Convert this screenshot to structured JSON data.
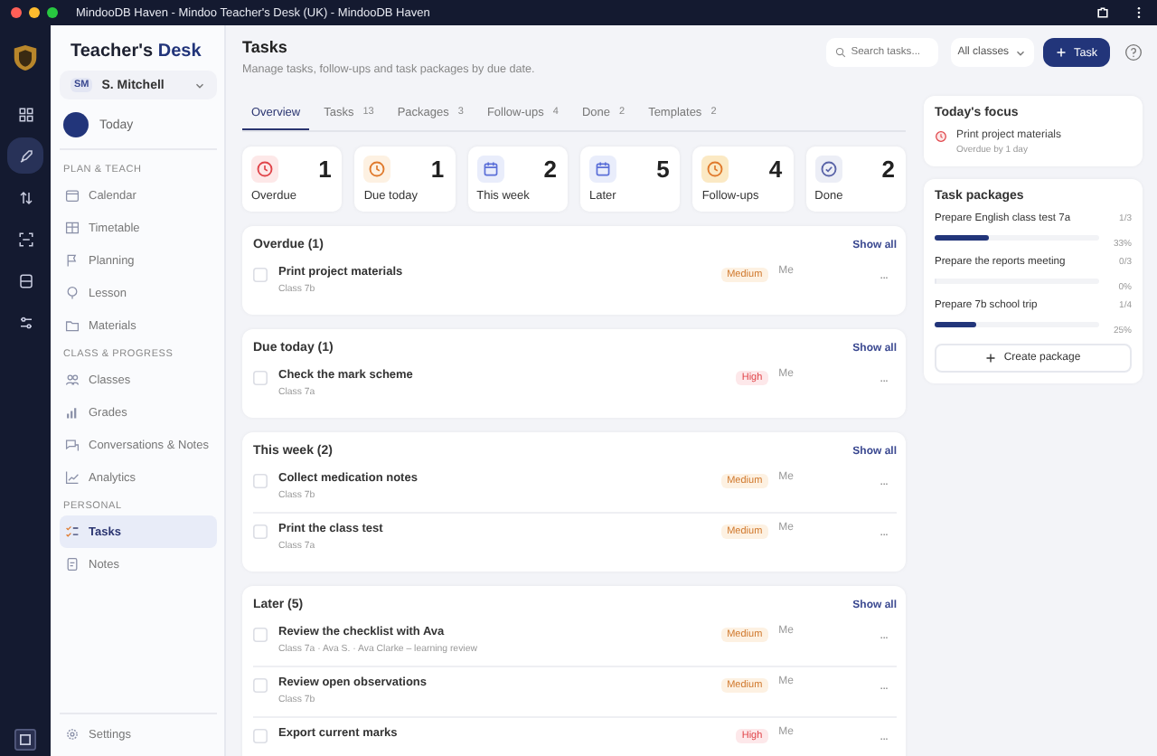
{
  "window": {
    "title": "MindooDB Haven - Mindoo Teacher's Desk (UK) - MindooDB Haven"
  },
  "rail": [
    {
      "selected": false
    },
    {
      "selected": true
    },
    {
      "selected": false
    },
    {
      "selected": false
    },
    {
      "selected": false
    },
    {
      "selected": false
    }
  ],
  "sidebar": {
    "brand": {
      "part_1": "Teacher's",
      "part_2": "Desk"
    },
    "user": {
      "initials": "SM",
      "name": "S. Mitchell"
    },
    "today": "Today",
    "groups": [
      {
        "heading": "PLAN & TEACH",
        "items": [
          {
            "label": "Calendar",
            "selected": false
          },
          {
            "label": "Timetable",
            "selected": false
          },
          {
            "label": "Planning",
            "selected": false
          },
          {
            "label": "Lesson",
            "selected": false
          },
          {
            "label": "Materials",
            "selected": false
          }
        ]
      },
      {
        "heading": "CLASS & PROGRESS",
        "items": [
          {
            "label": "Classes",
            "selected": false
          },
          {
            "label": "Grades",
            "selected": false
          },
          {
            "label": "Conversations & Notes",
            "selected": false
          },
          {
            "label": "Analytics",
            "selected": false
          }
        ]
      },
      {
        "heading": "PERSONAL",
        "items": [
          {
            "label": "Tasks",
            "selected": true
          },
          {
            "label": "Notes",
            "selected": false
          }
        ]
      }
    ],
    "settings": "Settings"
  },
  "header": {
    "title": "Tasks",
    "subtitle": "Manage tasks, follow-ups and task packages by due date.",
    "search": {
      "placeholder": "Search tasks..."
    },
    "class_filter": "All classes",
    "add_button": "Task"
  },
  "tabs": [
    {
      "label": "Overview",
      "selected": true
    },
    {
      "label": "Tasks",
      "count": "13",
      "selected": false
    },
    {
      "label": "Packages",
      "count": "3",
      "selected": false
    },
    {
      "label": "Follow-ups",
      "count": "4",
      "selected": false
    },
    {
      "label": "Done",
      "count": "2",
      "selected": false
    },
    {
      "label": "Templates",
      "count": "2",
      "selected": false
    }
  ],
  "stats": [
    {
      "kind": "overdue",
      "label": "Overdue",
      "value": "1"
    },
    {
      "kind": "due_today",
      "label": "Due today",
      "value": "1"
    },
    {
      "kind": "this_week",
      "label": "This week",
      "value": "2"
    },
    {
      "kind": "later",
      "label": "Later",
      "value": "5"
    },
    {
      "kind": "follow_ups",
      "label": "Follow-ups",
      "value": "4"
    },
    {
      "kind": "done",
      "label": "Done",
      "value": "2"
    }
  ],
  "sections": [
    {
      "title": "Overdue (1)",
      "show_all": "Show all",
      "tasks": [
        {
          "name": "Print project materials",
          "meta": "Class 7b",
          "checked": false,
          "priority": {
            "label": "Medium",
            "kind": "medium"
          },
          "assignee": "Me",
          "more": "..."
        }
      ]
    },
    {
      "title": "Due today (1)",
      "show_all": "Show all",
      "tasks": [
        {
          "name": "Check the mark scheme",
          "meta": "Class 7a",
          "checked": false,
          "priority": {
            "label": "High",
            "kind": "high"
          },
          "assignee": "Me",
          "more": "..."
        }
      ]
    },
    {
      "title": "This week (2)",
      "show_all": "Show all",
      "tasks": [
        {
          "name": "Collect medication notes",
          "meta": "Class 7b",
          "checked": false,
          "priority": {
            "label": "Medium",
            "kind": "medium"
          },
          "assignee": "Me",
          "more": "..."
        },
        {
          "name": "Print the class test",
          "meta": "Class 7a",
          "checked": false,
          "priority": {
            "label": "Medium",
            "kind": "medium"
          },
          "assignee": "Me",
          "more": "..."
        }
      ]
    },
    {
      "title": "Later (5)",
      "show_all": "Show all",
      "tasks": [
        {
          "name": "Review the checklist with Ava",
          "meta": "Class 7a · Ava S. · Ava Clarke – learning review",
          "checked": false,
          "priority": {
            "label": "Medium",
            "kind": "medium"
          },
          "assignee": "Me",
          "more": "..."
        },
        {
          "name": "Review open observations",
          "meta": "Class 7b",
          "checked": false,
          "priority": {
            "label": "Medium",
            "kind": "medium"
          },
          "assignee": "Me",
          "more": "..."
        },
        {
          "name": "Export current marks",
          "checked": false,
          "priority": {
            "label": "High",
            "kind": "high"
          },
          "assignee": "Me",
          "more": "..."
        }
      ]
    }
  ],
  "focus": {
    "title": "Today's focus",
    "item": {
      "name": "Print project materials",
      "note": "Overdue by 1 day"
    }
  },
  "packages": {
    "title": "Task packages",
    "items": [
      {
        "name": "Prepare English class test 7a",
        "count": "1/3",
        "level": 0.33,
        "percent": "33%"
      },
      {
        "name": "Prepare the reports meeting",
        "count": "0/3",
        "level": 0,
        "percent": "0%"
      },
      {
        "name": "Prepare 7b school trip",
        "count": "1/4",
        "level": 0.25,
        "percent": "25%"
      }
    ],
    "create_button": "Create package"
  }
}
